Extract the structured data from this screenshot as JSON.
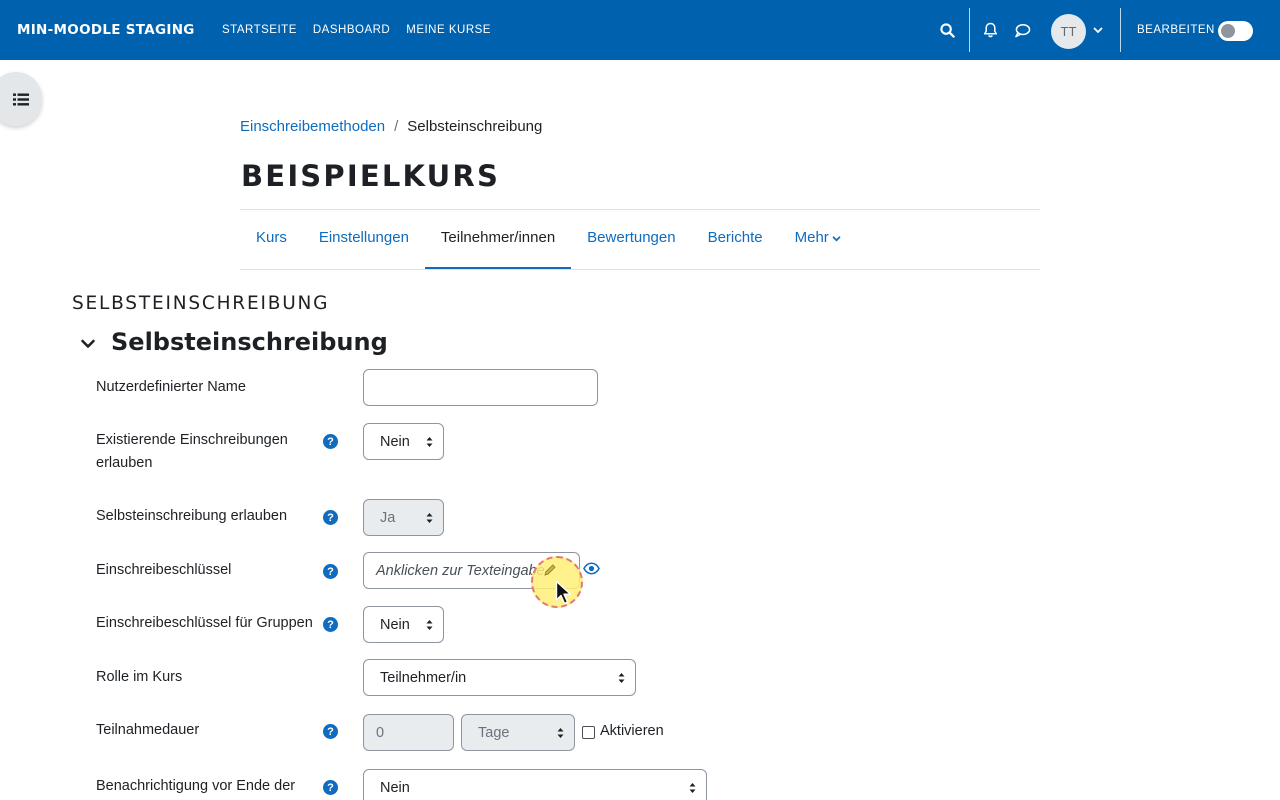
{
  "navbar": {
    "brand": "MIN-MOODLE STAGING",
    "links": [
      "STARTSEITE",
      "DASHBOARD",
      "MEINE KURSE"
    ],
    "avatar_initials": "TT",
    "edit_label": "BEARBEITEN",
    "edit_mode_on": false,
    "color": "#0061ae"
  },
  "breadcrumb": {
    "parent": "Einschreibemethoden",
    "separator": "/",
    "current": "Selbsteinschreibung"
  },
  "page_title": "BEISPIELKURS",
  "tabs": [
    "Kurs",
    "Einstellungen",
    "Teilnehmer/innen",
    "Bewertungen",
    "Berichte",
    "Mehr"
  ],
  "active_tab": "Teilnehmer/innen",
  "section_heading": "SELBSTEINSCHREIBUNG",
  "fieldset_legend": "Selbsteinschreibung",
  "form": {
    "custom_name": {
      "label": "Nutzerdefinierter Name",
      "value": ""
    },
    "existing_enrol": {
      "label_line1": "Existierende Einschreibungen",
      "label_line2": "erlauben",
      "value": "Nein"
    },
    "allow_self": {
      "label": "Selbsteinschreibung erlauben",
      "value": "Ja"
    },
    "enrol_key": {
      "label": "Einschreibeschlüssel",
      "value": "Anklicken zur Texteingabe"
    },
    "group_key": {
      "label": "Einschreibeschlüssel für Gruppen",
      "value": "Nein"
    },
    "role": {
      "label": "Rolle im Kurs",
      "value": "Teilnehmer/in"
    },
    "duration": {
      "label": "Teilnahmedauer",
      "number": "0",
      "unit": "Tage",
      "enable_label": "Aktivieren"
    },
    "notify": {
      "label": "Benachrichtigung vor Ende der",
      "value": "Nein"
    }
  },
  "help_icon": "question-circle-icon",
  "link_color": "#0f6cbf"
}
